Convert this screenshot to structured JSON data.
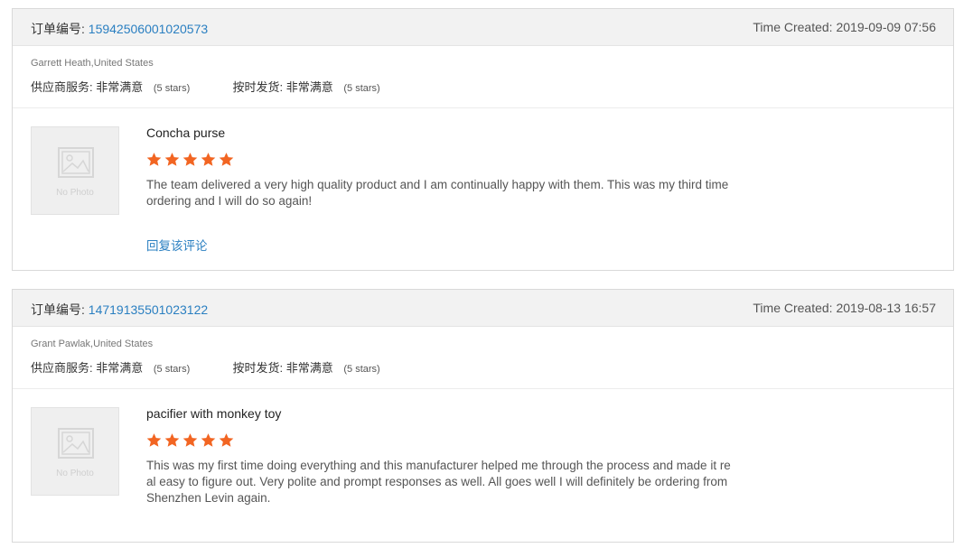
{
  "reviews": [
    {
      "order_label": "订单编号:",
      "order_number": "15942506001020573",
      "time_created": "Time Created: 2019-09-09 07:56",
      "buyer": "Garrett Heath,United States",
      "supplier_service_label": "供应商服务:",
      "supplier_service_value": "非常满意",
      "supplier_service_stars": "(5 stars)",
      "ontime_label": "按时发货:",
      "ontime_value": "非常满意",
      "ontime_stars": "(5 stars)",
      "photo_text": "No Photo",
      "product": "Concha purse",
      "rating": 5,
      "review_text": "The team delivered a very high quality product and I am continually happy with them. This was my third time ordering and I will do so again!",
      "reply_label": "回复该评论"
    },
    {
      "order_label": "订单编号:",
      "order_number": "14719135501023122",
      "time_created": "Time Created: 2019-08-13 16:57",
      "buyer": "Grant Pawlak,United States",
      "supplier_service_label": "供应商服务:",
      "supplier_service_value": "非常满意",
      "supplier_service_stars": "(5 stars)",
      "ontime_label": "按时发货:",
      "ontime_value": "非常满意",
      "ontime_stars": "(5 stars)",
      "photo_text": "No Photo",
      "product": "pacifier with monkey toy",
      "rating": 5,
      "review_text": "This was my first time doing everything and this manufacturer helped me through the process and made it real easy to figure out. Very polite and prompt responses as well. All goes well I will definitely be ordering from Shenzhen Levin again."
    }
  ],
  "colors": {
    "star": "#f26522",
    "link": "#2a7fc1"
  }
}
